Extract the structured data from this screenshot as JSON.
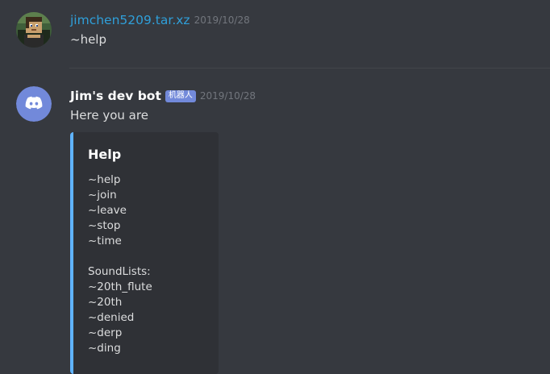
{
  "messages": [
    {
      "author": "jimchen5209.tar.xz",
      "timestamp": "2019/10/28",
      "text": "~help"
    },
    {
      "author": "Jim's dev bot",
      "bot_tag": "机器人",
      "timestamp": "2019/10/28",
      "text": "Here you are",
      "embed": {
        "title": "Help",
        "lines": [
          "~help",
          "~join",
          "~leave",
          "~stop",
          "~time",
          "",
          "SoundLists:",
          "~20th_flute",
          "~20th",
          "~denied",
          "~derp",
          "~ding"
        ],
        "accent_color": "#5fb3ff"
      }
    }
  ],
  "colors": {
    "background": "#36393f",
    "embed_bg": "#2f3136",
    "user_name": "#2f9fd9",
    "bot_tag": "#7289da",
    "blurple": "#7289da"
  },
  "icons": {
    "user_avatar": "minecraft-skin-avatar",
    "bot_avatar": "discord-logo-avatar"
  }
}
